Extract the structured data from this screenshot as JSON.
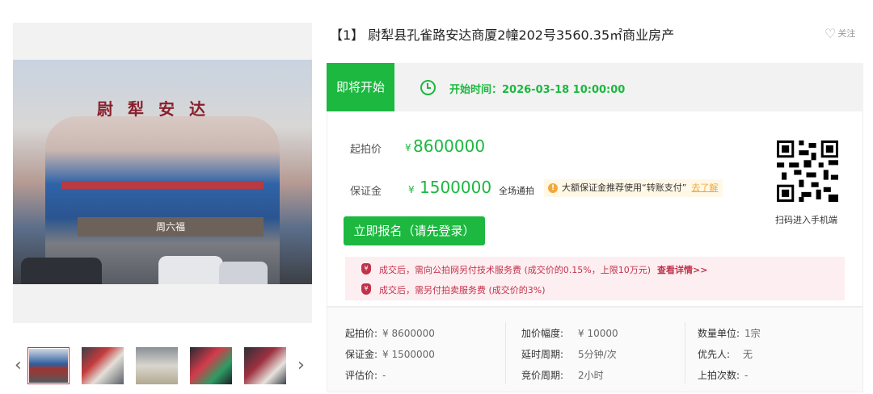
{
  "gallery": {
    "sign_text": "尉犁安达",
    "shop_text": "周六福",
    "thumbnails": [
      "thumb-1",
      "thumb-2",
      "thumb-3",
      "thumb-4",
      "thumb-5"
    ],
    "prev_icon": "chevron-left-icon",
    "next_icon": "chevron-right-icon"
  },
  "header": {
    "title": "【1】 尉犁县孔雀路安达商厦2幢202号3560.35㎡商业房产",
    "follow_label": "关注"
  },
  "status": {
    "tag": "即将开始",
    "start_time": "开始时间：2026-03-18 10:00:00"
  },
  "pricing": {
    "start_label": "起拍价",
    "start_yen": "¥",
    "start_value": "8600000",
    "deposit_label": "保证金",
    "deposit_yen": "¥",
    "deposit_value": "1500000",
    "deposit_scope": "全场通拍",
    "tip_text": "大额保证金推荐使用“转账支付”",
    "tip_link": "去了解",
    "register_button": "立即报名（请先登录）",
    "qr_caption": "扫码进入手机端"
  },
  "fees": {
    "line1": "成交后，需向公拍网另付技术服务费 (成交价的0.15%，上限10万元)",
    "line1_link": "查看详情>>",
    "line2": "成交后，需另付拍卖服务费 (成交价的3%)"
  },
  "info": {
    "col1": [
      {
        "k": "起拍价:",
        "v": "¥ 8600000"
      },
      {
        "k": "保证金:",
        "v": "¥ 1500000"
      },
      {
        "k": "评估价:",
        "v": "-"
      }
    ],
    "col2": [
      {
        "k": "加价幅度:",
        "v": "¥ 10000"
      },
      {
        "k": "延时周期:",
        "v": "5分钟/次"
      },
      {
        "k": "竞价周期:",
        "v": "2小时"
      }
    ],
    "col3": [
      {
        "k": "数量单位:",
        "v": "1宗"
      },
      {
        "k": "优先人:",
        "v": "无"
      },
      {
        "k": "上拍次数:",
        "v": "-"
      }
    ]
  },
  "colors": {
    "accent_green": "#1cb840",
    "fee_red": "#c0334b",
    "tip_orange": "#f3a83b"
  }
}
